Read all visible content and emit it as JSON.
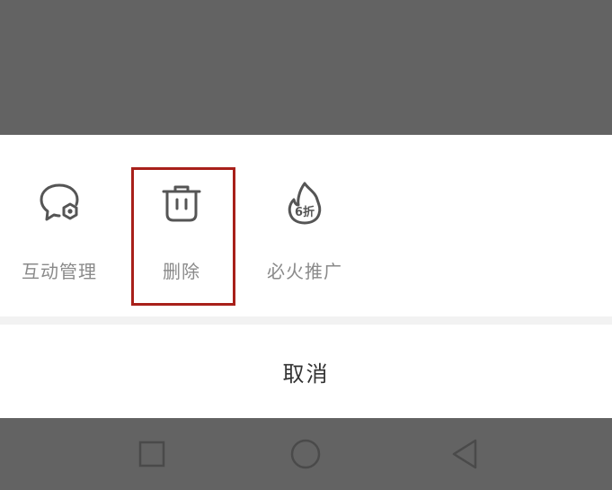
{
  "dim_overlay_color": "#636363",
  "action_sheet": {
    "actions": [
      {
        "label": "互动管理",
        "icon": "chat-bubble-gear-icon"
      },
      {
        "label": "删除",
        "icon": "trash-can-icon",
        "highlighted": true
      },
      {
        "label": "必火推广",
        "icon": "flame-discount-icon",
        "badge_text": "6折"
      }
    ],
    "highlight_color": "#a8201a",
    "cancel_label": "取消"
  },
  "nav_bar": {
    "buttons": [
      {
        "icon": "recent-apps-square-icon"
      },
      {
        "icon": "home-circle-icon"
      },
      {
        "icon": "back-triangle-icon"
      }
    ]
  }
}
